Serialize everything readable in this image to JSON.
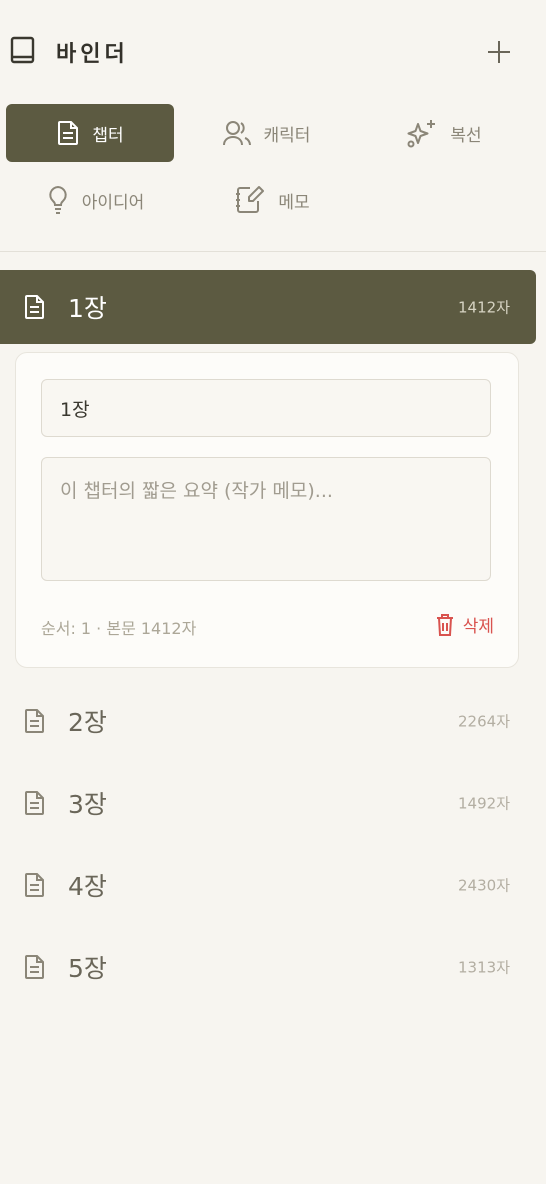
{
  "header": {
    "title": "바인더",
    "add_label": "+"
  },
  "tabs": [
    {
      "label": "챕터",
      "icon": "document-icon",
      "active": true
    },
    {
      "label": "캐릭터",
      "icon": "users-icon",
      "active": false
    },
    {
      "label": "복선",
      "icon": "sparkles-icon",
      "active": false
    },
    {
      "label": "아이디어",
      "icon": "lightbulb-icon",
      "active": false
    },
    {
      "label": "메모",
      "icon": "notebook-pen-icon",
      "active": false
    }
  ],
  "chapters": [
    {
      "name": "1장",
      "count": "1412자",
      "active": true
    },
    {
      "name": "2장",
      "count": "2264자",
      "active": false
    },
    {
      "name": "3장",
      "count": "1492자",
      "active": false
    },
    {
      "name": "4장",
      "count": "2430자",
      "active": false
    },
    {
      "name": "5장",
      "count": "1313자",
      "active": false
    }
  ],
  "editor": {
    "name_value": "1장",
    "summary_value": "",
    "summary_placeholder": "이 챕터의 짧은 요약 (작가 메모)...",
    "meta": "순서: 1 · 본문 1412자",
    "delete_label": "삭제"
  },
  "colors": {
    "accent": "#5c5a41",
    "background": "#f7f5f0",
    "danger": "#d9534f"
  }
}
